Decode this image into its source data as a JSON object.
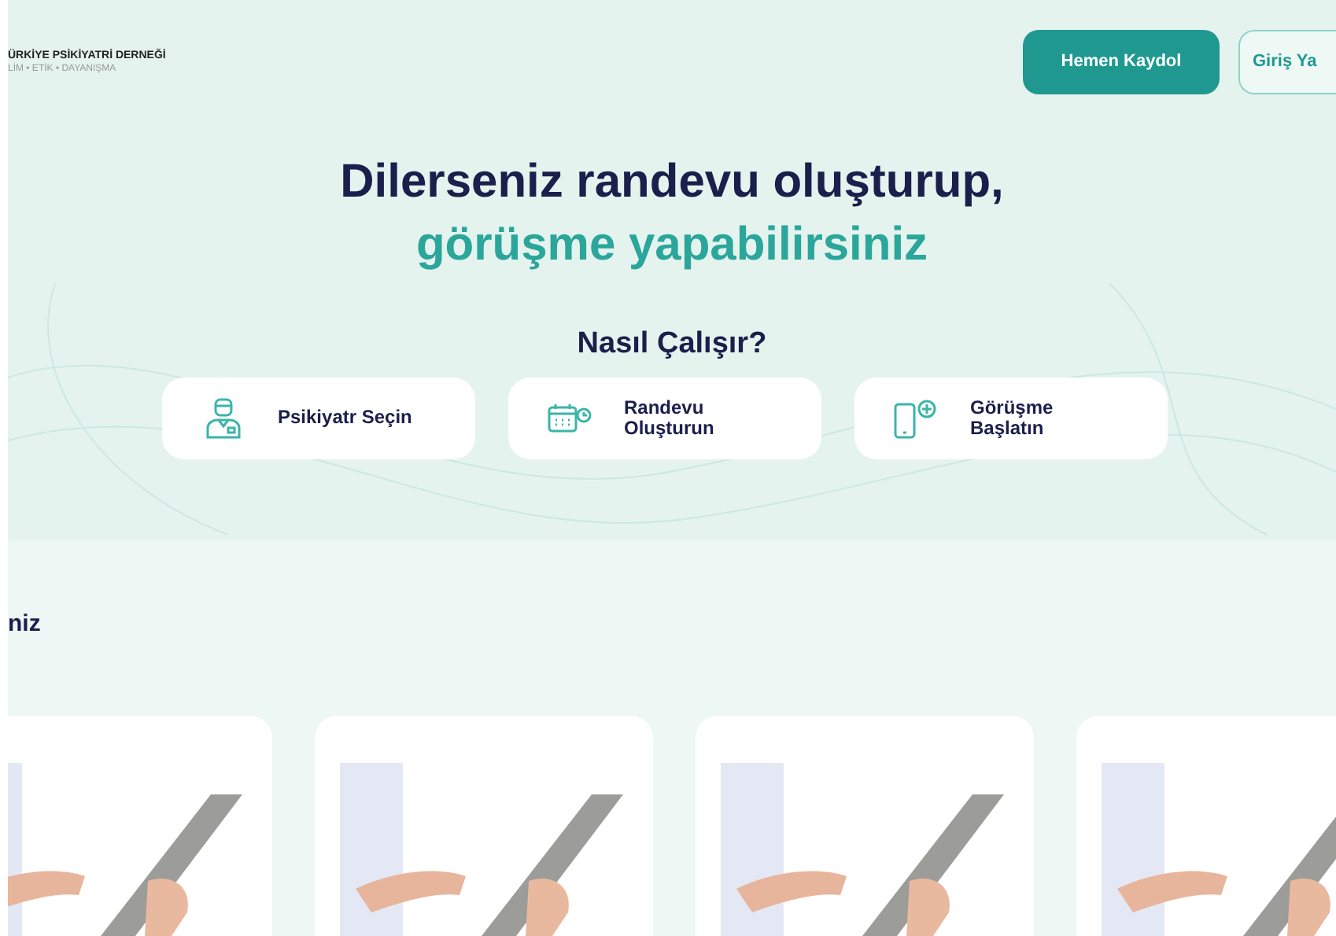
{
  "header": {
    "logo_title": "ÜRKİYE PSİKİYATRİ DERNEĞİ",
    "logo_tagline": "LİM • ETİK • DAYANIŞMA",
    "buttons": [
      {
        "label": "Hemen Kaydol",
        "kind": "primary"
      },
      {
        "label": "Giriş Ya",
        "kind": "outline"
      }
    ]
  },
  "hero": {
    "title_line1": "Dilerseniz randevu oluşturup,",
    "title_line2": "görüşme yapabilirsiniz",
    "steps_title": "Nasıl Çalışır?",
    "steps": [
      {
        "label": "Psikiyatr Seçin",
        "kind": "doctor"
      },
      {
        "label": "Randevu Oluşturun",
        "kind": "calendar"
      },
      {
        "label": "Görüşme Başlatın",
        "kind": "phone"
      }
    ]
  },
  "section": {
    "title": "niz",
    "cards": [
      {
        "kind": "photo"
      },
      {
        "kind": "photo"
      },
      {
        "kind": "photo"
      },
      {
        "kind": "photo"
      }
    ]
  }
}
